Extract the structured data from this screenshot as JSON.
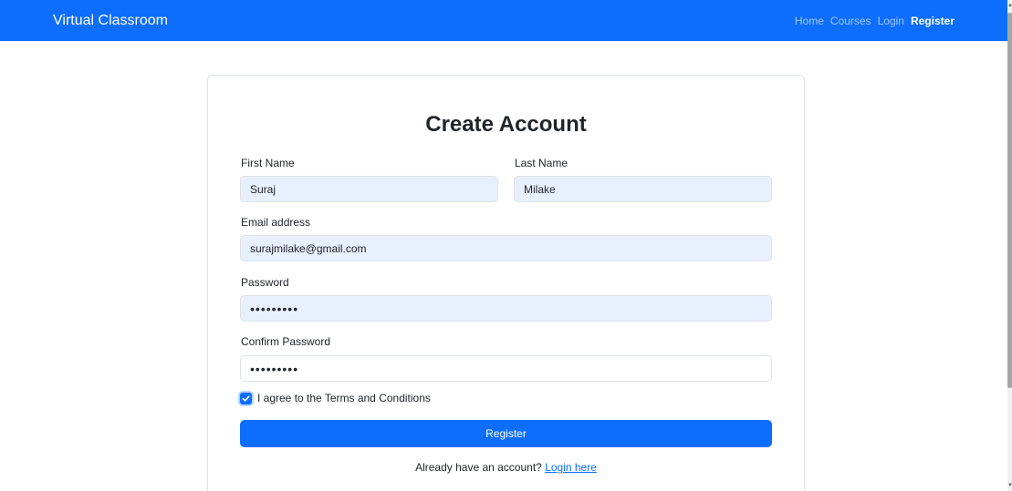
{
  "nav": {
    "brand": "Virtual Classroom",
    "links": [
      "Home",
      "Courses",
      "Login",
      "Register"
    ],
    "active": "Register"
  },
  "form": {
    "title": "Create Account",
    "first_name": {
      "label": "First Name",
      "value": "Suraj"
    },
    "last_name": {
      "label": "Last Name",
      "value": "Milake"
    },
    "email": {
      "label": "Email address",
      "value": "surajmilake@gmail.com"
    },
    "password": {
      "label": "Password",
      "value": "•••••••••"
    },
    "confirm_password": {
      "label": "Confirm Password",
      "value": "•••••••••"
    },
    "terms": {
      "label": "I agree to the Terms and Conditions",
      "checked": true
    },
    "submit_label": "Register",
    "footer_prompt": "Already have an account?",
    "footer_link": "Login here"
  },
  "colors": {
    "primary": "#0d6efd",
    "autofill": "#e8f0fe"
  }
}
